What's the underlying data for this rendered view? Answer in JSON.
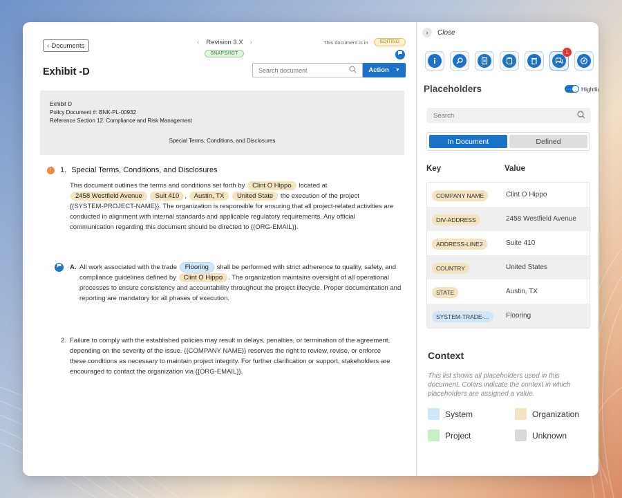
{
  "document": {
    "back_label": "Documents",
    "revision": "Revision 3.X",
    "snapshot_label": "SNAPSHOT",
    "status_text": "This document is in",
    "status_badge": "EDITING",
    "title": "Exhibit -D",
    "search_placeholder": "Search document",
    "action_label": "Action",
    "header": {
      "line1": "Exhibit D",
      "line2": "Policy Document #: BNK-PL-00932",
      "line3": "Reference Section 12: Compliance and Risk Management",
      "center": "Special Terms, Conditions, and Disclosures"
    },
    "section1": {
      "number": "1.",
      "heading": "Special Terms, Conditions, and Disclosures",
      "t1": "This document outlines the terms and conditions set forth by",
      "chip_company": "Clint O Hippo",
      "t2": "located at",
      "chip_address": "2458 Westfield Avenue",
      "chip_suite": "Suit 410",
      "comma": ",",
      "chip_city": "Austin, TX",
      "chip_country": "United State",
      "t3": "the execution of the project {{SYSTEM-PROJECT-NAME}}. The organization is responsible for ensuring that all project-related activities are conducted in alignment with internal standards and applicable regulatory requirements. Any official communication regarding this document should be directed to {{ORG-EMAIL}}."
    },
    "sectionA": {
      "letter": "A.",
      "t1": "All work associated with the trade",
      "chip_trade": "Flooring",
      "t2": "shall be performed with strict adherence to quality, safety, and compliance guidelines defined by",
      "chip_company": "Clint O Hippo",
      "t3": ". The organization maintains oversight of all operational processes to ensure consistency and accountability throughout the project lifecycle. Proper documentation and reporting are mandatory for all phases of execution."
    },
    "section2": {
      "number": "2.",
      "text": "Failure to comply with the established policies may result in delays, penalties, or termination of the agreement, depending on the severity of the issue. {{COMPANY NAME}} reserves the right to review, revise, or enforce these conditions as necessary to maintain project integrity. For further clarification or support, stakeholders are encouraged to contact the organization via {{ORG-EMAIL}}."
    }
  },
  "sidebar": {
    "close_label": "Close",
    "tools": [
      "info-icon",
      "search-key-icon",
      "document-list-icon",
      "clipboard-icon",
      "recycle-bin-icon",
      "chat-icon",
      "compass-icon"
    ],
    "chat_badge": "1",
    "title": "Placeholders",
    "highlight_label": "Hightlight",
    "search_placeholder": "Search",
    "tab_in_document": "In Document",
    "tab_defined": "Defined",
    "key_header": "Key",
    "value_header": "Value",
    "rows": [
      {
        "key": "COMPANY NAME",
        "value": "Clint O Hippo",
        "context": "organization"
      },
      {
        "key": "DIV-ADDRESS",
        "value": "2458 Westfield Avenue",
        "context": "organization"
      },
      {
        "key": "ADDRESS-LINE2",
        "value": "Suite 410",
        "context": "organization"
      },
      {
        "key": "COUNTRY",
        "value": "United States",
        "context": "organization"
      },
      {
        "key": "STATE",
        "value": "Austin, TX",
        "context": "organization"
      },
      {
        "key": "SYSTEM-TRADE-...",
        "value": "Flooring",
        "context": "system"
      }
    ],
    "context_title": "Context",
    "context_desc": "This list shows all placeholders used in this document. Colors indicate the context in which placeholders are assigned a value.",
    "legend": {
      "system": "System",
      "organization": "Organization",
      "project": "Project",
      "unknown": "Unknown"
    },
    "colors": {
      "system": "#cfe6fb",
      "organization": "#f3e3bf",
      "project": "#c8f0c8",
      "unknown": "#d9d9d9",
      "accent": "#1a73c8"
    }
  }
}
